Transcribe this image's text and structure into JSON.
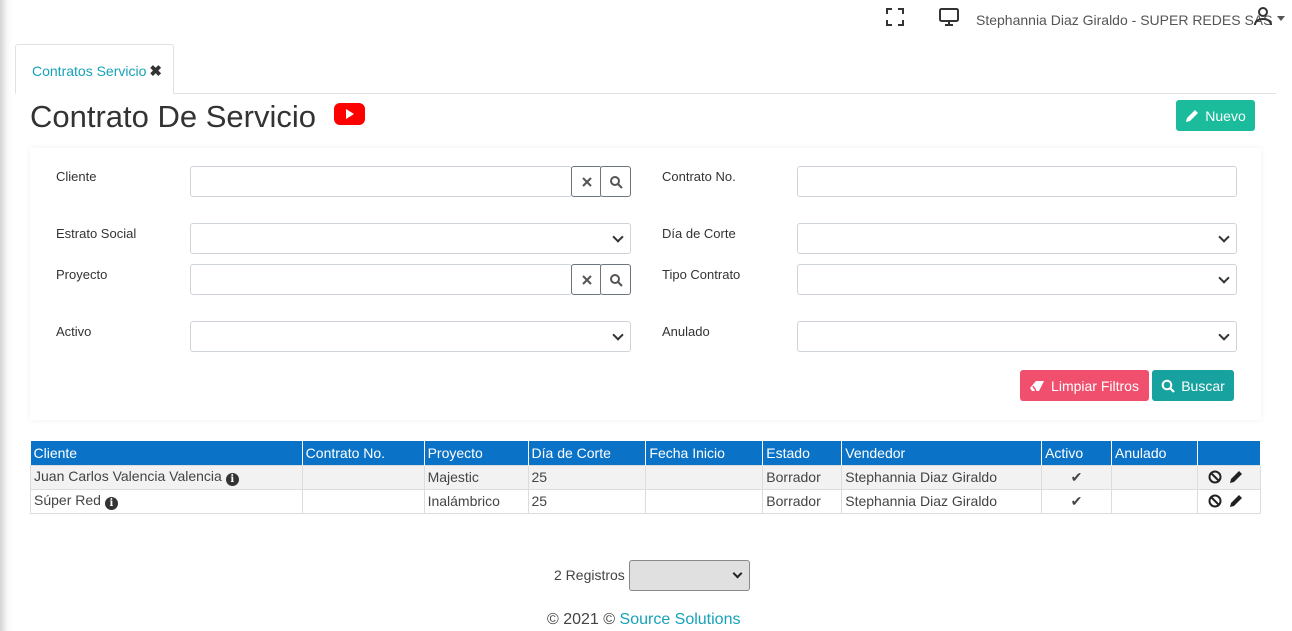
{
  "topbar": {
    "user_label": "Stephannia Diaz Giraldo - SUPER REDES SAS"
  },
  "tabs": [
    {
      "label": "Contratos Servicio",
      "close": "✖"
    }
  ],
  "page": {
    "title": "Contrato De Servicio",
    "new_button": "Nuevo"
  },
  "filters": {
    "cliente": {
      "label": "Cliente",
      "value": ""
    },
    "contrato": {
      "label": "Contrato No.",
      "value": ""
    },
    "estrato": {
      "label": "Estrato Social",
      "value": ""
    },
    "dia_corte": {
      "label": "Día de Corte",
      "value": ""
    },
    "proyecto": {
      "label": "Proyecto",
      "value": ""
    },
    "tipo_contrato": {
      "label": "Tipo Contrato",
      "value": ""
    },
    "activo": {
      "label": "Activo",
      "value": ""
    },
    "anulado": {
      "label": "Anulado",
      "value": ""
    },
    "clear_button": "Limpiar Filtros",
    "search_button": "Buscar"
  },
  "table": {
    "columns": [
      "Cliente",
      "Contrato No.",
      "Proyecto",
      "Día de Corte",
      "Fecha Inicio",
      "Estado",
      "Vendedor",
      "Activo",
      "Anulado",
      ""
    ],
    "rows": [
      {
        "cliente": "Juan Carlos Valencia Valencia",
        "contrato": "",
        "proyecto": "Majestic",
        "dia_corte": "25",
        "fecha_inicio": "",
        "estado": "Borrador",
        "vendedor": "Stephannia Diaz Giraldo",
        "activo": "✔",
        "anulado": ""
      },
      {
        "cliente": "Súper Red",
        "contrato": "",
        "proyecto": "Inalámbrico",
        "dia_corte": "25",
        "fecha_inicio": "",
        "estado": "Borrador",
        "vendedor": "Stephannia Diaz Giraldo",
        "activo": "✔",
        "anulado": ""
      }
    ]
  },
  "footer": {
    "records": "2 Registros",
    "page_size": "",
    "copyright": "© 2021 © ",
    "company_link": "Source Solutions"
  },
  "colors": {
    "accent": "#17a2b8",
    "header_blue": "#0b73c7",
    "new_green": "#1abc9c",
    "clear_red": "#f0506e",
    "search_teal": "#17a2a0",
    "youtube_red": "#ff0000"
  }
}
